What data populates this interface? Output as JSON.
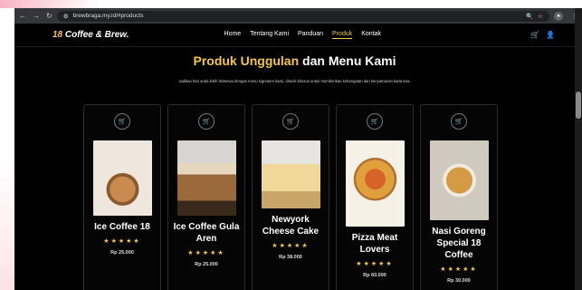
{
  "browser": {
    "url": "brewbraga.my.id/#products",
    "back_icon": "arrow-left-icon",
    "forward_icon": "arrow-right-icon",
    "reload_icon": "reload-icon"
  },
  "site": {
    "brand_num": "18",
    "brand_text": " Coffee & Brew.",
    "nav": [
      {
        "label": "Home"
      },
      {
        "label": "Tentang Kami"
      },
      {
        "label": "Panduan"
      },
      {
        "label": "Produk"
      },
      {
        "label": "Kontak"
      }
    ],
    "active_nav": "Produk"
  },
  "section": {
    "title_gold": "Produk Unggulan",
    "title_rest": " dan Menu Kami",
    "subtitle": "Jadikan hari anda lebih istimewa dengan menu signature kami, diracik khusus untuk memberikan kehangatan dan kenyamanan tiada tara."
  },
  "products": [
    {
      "name": "Ice Coffee 18",
      "price": "Rp 25.000",
      "stars": "★★★★★"
    },
    {
      "name": "Ice Coffee Gula Aren",
      "price": "Rp 25.000",
      "stars": "★★★★★"
    },
    {
      "name": "Newyork Cheese Cake",
      "price": "Rp 38.000",
      "stars": "★★★★★"
    },
    {
      "name": "Pizza Meat Lovers",
      "price": "Rp 60.000",
      "stars": "★★★★★"
    },
    {
      "name": "Nasi Goreng Special 18 Coffee",
      "price": "Rp 30.000",
      "stars": "★★★★★"
    }
  ],
  "colors": {
    "accent": "#f5c451",
    "background": "#000000",
    "decor": "#e11d48"
  }
}
